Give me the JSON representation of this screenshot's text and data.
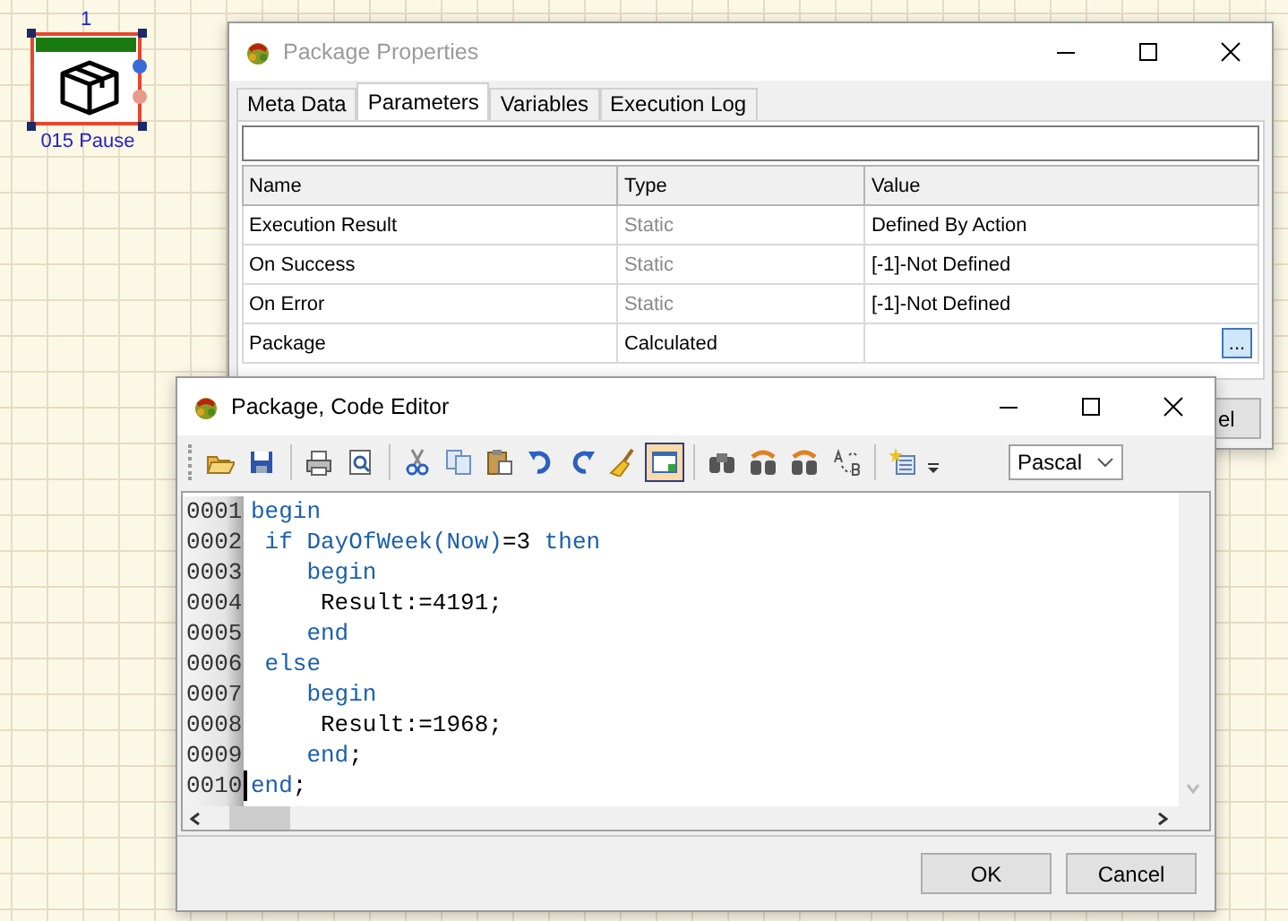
{
  "canvas_node": {
    "number": "1",
    "label": "015 Pause",
    "selected": true
  },
  "properties_window": {
    "title": "Package Properties",
    "tabs": [
      {
        "label": "Meta Data",
        "selected": false
      },
      {
        "label": "Parameters",
        "selected": true
      },
      {
        "label": "Variables",
        "selected": false
      },
      {
        "label": "Execution Log",
        "selected": false
      }
    ],
    "table": {
      "columns": [
        "Name",
        "Type",
        "Value"
      ],
      "rows": [
        {
          "name": "Execution Result",
          "type": "Static",
          "type_greyed": true,
          "value": "Defined By Action"
        },
        {
          "name": "On Success",
          "type": "Static",
          "type_greyed": true,
          "value": "[-1]-Not Defined"
        },
        {
          "name": "On Error",
          "type": "Static",
          "type_greyed": true,
          "value": "[-1]-Not Defined"
        },
        {
          "name": "Package",
          "type": "Calculated",
          "type_greyed": false,
          "value_button": "..."
        }
      ]
    },
    "partly_hidden_button": "el"
  },
  "code_editor": {
    "title": "Package, Code Editor",
    "toolbar": [
      {
        "kind": "grip"
      },
      {
        "kind": "open",
        "selected": false
      },
      {
        "kind": "save",
        "selected": false
      },
      {
        "kind": "separator"
      },
      {
        "kind": "print",
        "selected": false
      },
      {
        "kind": "preview",
        "selected": false
      },
      {
        "kind": "separator"
      },
      {
        "kind": "cut",
        "selected": false
      },
      {
        "kind": "copy",
        "selected": false
      },
      {
        "kind": "paste",
        "selected": false
      },
      {
        "kind": "undo",
        "selected": false
      },
      {
        "kind": "redo",
        "selected": false
      },
      {
        "kind": "clear",
        "selected": false
      },
      {
        "kind": "window",
        "selected": true
      },
      {
        "kind": "separator"
      },
      {
        "kind": "find",
        "selected": false
      },
      {
        "kind": "find_next",
        "selected": false
      },
      {
        "kind": "find_prev",
        "selected": false
      },
      {
        "kind": "replace",
        "selected": false
      },
      {
        "kind": "separator"
      },
      {
        "kind": "list",
        "selected": false
      },
      {
        "kind": "more"
      }
    ],
    "language": "Pascal",
    "lines": [
      {
        "number": "0001",
        "cursor": false,
        "tokens": [
          {
            "kind": "keyword",
            "text": "begin"
          }
        ]
      },
      {
        "number": "0002",
        "cursor": false,
        "tokens": [
          {
            "kind": "keyword",
            "text": " if"
          },
          {
            "kind": "keyword",
            "text": " DayOfWeek(Now)"
          },
          {
            "kind": "plain",
            "text": "=3 "
          },
          {
            "kind": "keyword",
            "text": "then"
          }
        ]
      },
      {
        "number": "0003",
        "cursor": false,
        "tokens": [
          {
            "kind": "keyword",
            "text": "    begin"
          }
        ]
      },
      {
        "number": "0004",
        "cursor": false,
        "tokens": [
          {
            "kind": "plain",
            "text": "     Result:=4191;"
          }
        ]
      },
      {
        "number": "0005",
        "cursor": false,
        "tokens": [
          {
            "kind": "keyword",
            "text": "    end"
          }
        ]
      },
      {
        "number": "0006",
        "cursor": false,
        "tokens": [
          {
            "kind": "keyword",
            "text": " else"
          }
        ]
      },
      {
        "number": "0007",
        "cursor": false,
        "tokens": [
          {
            "kind": "keyword",
            "text": "    begin"
          }
        ]
      },
      {
        "number": "0008",
        "cursor": false,
        "tokens": [
          {
            "kind": "plain",
            "text": "     Result:=1968;"
          }
        ]
      },
      {
        "number": "0009",
        "cursor": false,
        "tokens": [
          {
            "kind": "keyword",
            "text": "    end"
          },
          {
            "kind": "plain",
            "text": ";"
          }
        ]
      },
      {
        "number": "0010",
        "cursor": true,
        "tokens": [
          {
            "kind": "keyword",
            "text": "end"
          },
          {
            "kind": "plain",
            "text": ";"
          }
        ]
      }
    ],
    "buttons": [
      "OK",
      "Cancel"
    ]
  }
}
